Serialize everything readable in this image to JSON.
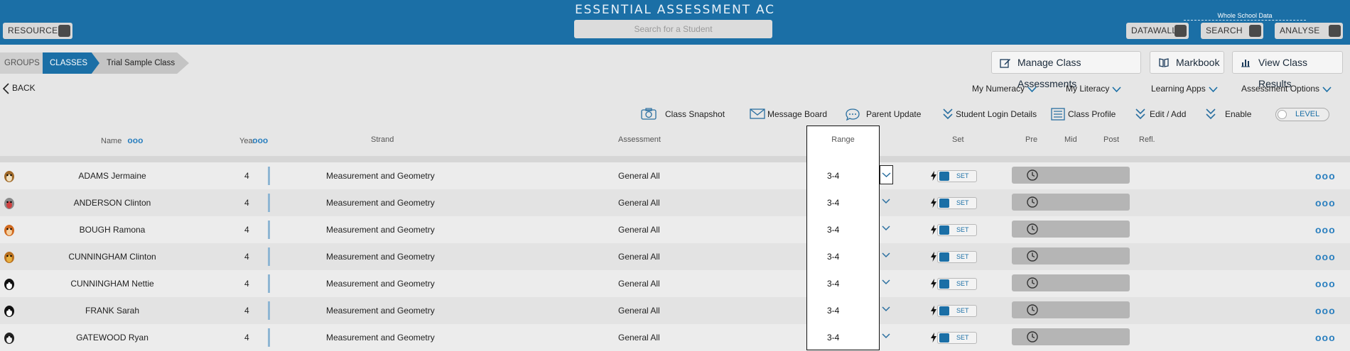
{
  "header": {
    "app_title": "ESSENTIAL ASSESSMENT AC",
    "resources_label": "RESOURCES",
    "search_placeholder": "Search for a Student",
    "whole_school_label": "Whole School Data",
    "datawall_label": "DATAWALL",
    "search_label": "SEARCH",
    "analyse_label": "ANALYSE"
  },
  "breadcrumb": {
    "groups": "GROUPS",
    "classes": "CLASSES",
    "current": "Trial Sample Class"
  },
  "actions": {
    "manage": "Manage Class Assessments",
    "markbook": "Markbook",
    "results": "View Class Results"
  },
  "nav": {
    "back": "BACK",
    "menus": [
      "My Numeracy",
      "My Literacy",
      "Learning Apps",
      "Assessment Options"
    ]
  },
  "toolbar": {
    "snapshot": "Class Snapshot",
    "message": "Message Board",
    "parent": "Parent Update",
    "login": "Student Login Details",
    "profile": "Class Profile",
    "edit": "Edit / Add",
    "enable": "Enable",
    "level": "LEVEL"
  },
  "table": {
    "headers": {
      "name": "Name",
      "year": "Year",
      "strand": "Strand",
      "assessment": "Assessment",
      "range": "Range",
      "set": "Set",
      "pre": "Pre",
      "mid": "Mid",
      "post": "Post",
      "refl": "Refl."
    },
    "set_label": "SET",
    "rows": [
      {
        "name": "ADAMS Jermaine",
        "year": "4",
        "strand": "Measurement and Geometry",
        "assessment": "General All",
        "range": "3-4",
        "avatar": "fox-icon"
      },
      {
        "name": "ANDERSON Clinton",
        "year": "4",
        "strand": "Measurement and Geometry",
        "assessment": "General All",
        "range": "3-4",
        "avatar": "koala-icon"
      },
      {
        "name": "BOUGH Ramona",
        "year": "4",
        "strand": "Measurement and Geometry",
        "assessment": "General All",
        "range": "3-4",
        "avatar": "cat-icon"
      },
      {
        "name": "CUNNINGHAM Clinton",
        "year": "4",
        "strand": "Measurement and Geometry",
        "assessment": "General All",
        "range": "3-4",
        "avatar": "lion-icon"
      },
      {
        "name": "CUNNINGHAM Nettie",
        "year": "4",
        "strand": "Measurement and Geometry",
        "assessment": "General All",
        "range": "3-4",
        "avatar": "penguin-icon"
      },
      {
        "name": "FRANK Sarah",
        "year": "4",
        "strand": "Measurement and Geometry",
        "assessment": "General All",
        "range": "3-4",
        "avatar": "penguin-icon"
      },
      {
        "name": "GATEWOOD Ryan",
        "year": "4",
        "strand": "Measurement and Geometry",
        "assessment": "General All",
        "range": "3-4",
        "avatar": "panda-icon"
      }
    ]
  },
  "colors": {
    "primary": "#1b6fa6",
    "accent_dots": "#2a7fbf"
  }
}
